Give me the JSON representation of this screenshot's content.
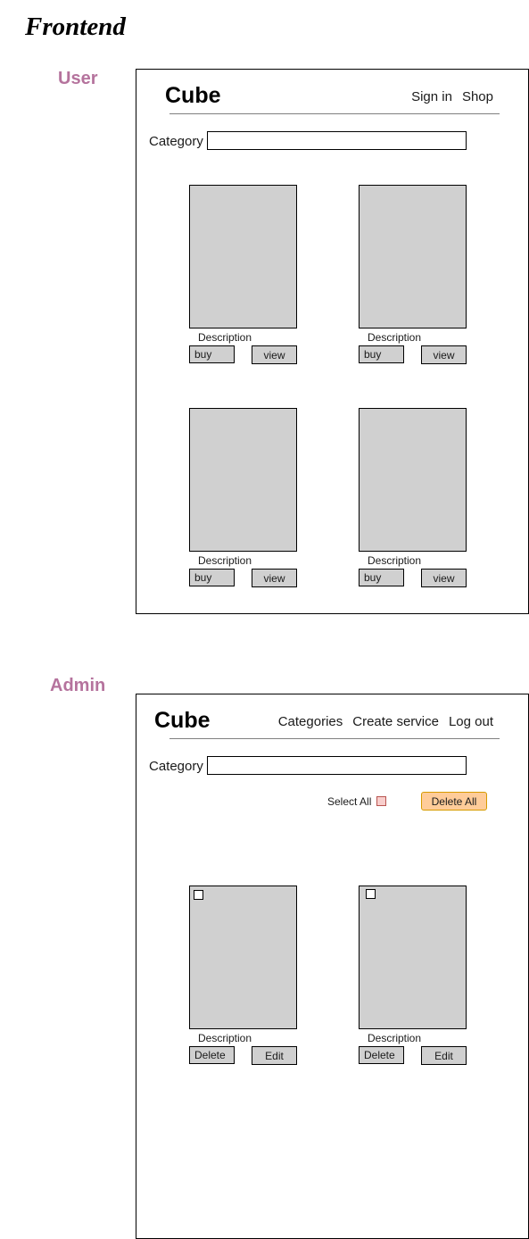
{
  "title": "Frontend",
  "user": {
    "label": "User",
    "logo": "Cube",
    "nav": [
      "Sign in",
      "Shop"
    ],
    "category_label": "Category",
    "category_value": "",
    "cards": [
      {
        "description": "Description",
        "btn1": "buy",
        "btn2": "view"
      },
      {
        "description": "Description",
        "btn1": "buy",
        "btn2": "view"
      },
      {
        "description": "Description",
        "btn1": "buy",
        "btn2": "view"
      },
      {
        "description": "Description",
        "btn1": "buy",
        "btn2": "view"
      }
    ]
  },
  "admin": {
    "label": "Admin",
    "logo": "Cube",
    "nav": [
      "Categories",
      "Create service",
      "Log out"
    ],
    "category_label": "Category",
    "category_value": "",
    "select_all": "Select All",
    "delete_all": "Delete All",
    "cards": [
      {
        "description": "Description",
        "btn1": "Delete",
        "btn2": "Edit"
      },
      {
        "description": "Description",
        "btn1": "Delete",
        "btn2": "Edit"
      }
    ]
  },
  "colors": {
    "section_label": "#b5739d",
    "card_fill": "#d0d0d0",
    "delete_all_fill": "#ffcc99",
    "select_all_checkbox": "#f8cecc"
  }
}
